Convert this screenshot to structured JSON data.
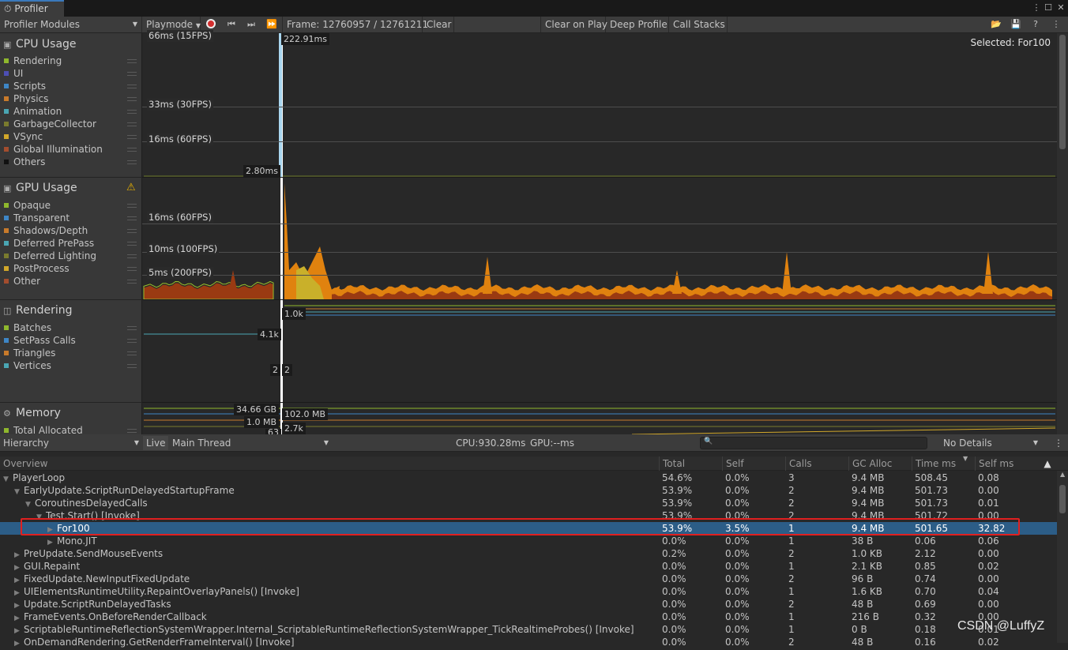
{
  "window": {
    "tab_label": "Profiler"
  },
  "toolbar": {
    "modules_label": "Profiler Modules",
    "playmode_label": "Playmode",
    "frame_label": "Frame: 12760957 / 12761211",
    "clear_label": "Clear",
    "clear_on_play_label": "Clear on Play",
    "deep_profile_label": "Deep Profile",
    "call_stacks_label": "Call Stacks"
  },
  "modules": {
    "cpu": {
      "title": "CPU Usage",
      "legend": [
        {
          "label": "Rendering",
          "color": "#8fb82d"
        },
        {
          "label": "UI",
          "color": "#4d4fb5"
        },
        {
          "label": "Scripts",
          "color": "#3e86c6"
        },
        {
          "label": "Physics",
          "color": "#c87a2b"
        },
        {
          "label": "Animation",
          "color": "#4aa6b3"
        },
        {
          "label": "GarbageCollector",
          "color": "#7a7b2e"
        },
        {
          "label": "VSync",
          "color": "#d1a72a"
        },
        {
          "label": "Global Illumination",
          "color": "#a34d2e"
        },
        {
          "label": "Others",
          "color": "#111111"
        }
      ]
    },
    "gpu": {
      "title": "GPU Usage",
      "legend": [
        {
          "label": "Opaque",
          "color": "#8fb82d"
        },
        {
          "label": "Transparent",
          "color": "#3e86c6"
        },
        {
          "label": "Shadows/Depth",
          "color": "#c87a2b"
        },
        {
          "label": "Deferred PrePass",
          "color": "#4aa6b3"
        },
        {
          "label": "Deferred Lighting",
          "color": "#7a7b2e"
        },
        {
          "label": "PostProcess",
          "color": "#d1a72a"
        },
        {
          "label": "Other",
          "color": "#a34d2e"
        }
      ]
    },
    "rendering": {
      "title": "Rendering",
      "legend": [
        {
          "label": "Batches",
          "color": "#8fb82d"
        },
        {
          "label": "SetPass Calls",
          "color": "#3e86c6"
        },
        {
          "label": "Triangles",
          "color": "#c87a2b"
        },
        {
          "label": "Vertices",
          "color": "#4aa6b3"
        }
      ]
    },
    "memory": {
      "title": "Memory",
      "legend": [
        {
          "label": "Total Allocated",
          "color": "#8fb82d"
        }
      ]
    }
  },
  "charts": {
    "selected_label": "Selected: For100",
    "cpu": {
      "top": "66ms (15FPS)",
      "l33": "33ms (30FPS)",
      "l16": "16ms (60FPS)",
      "frame_value": "222.91ms",
      "cur_value": "2.80ms"
    },
    "gpu": {
      "l16": "16ms (60FPS)",
      "l10": "10ms (100FPS)",
      "l5": "5ms (200FPS)"
    },
    "rendering": {
      "v1": "1.0k",
      "v2": "4.1k",
      "v3": "2",
      "v4": "2"
    },
    "memory": {
      "v1": "34.66 GB",
      "v2": "102.0 MB",
      "v3": "1.0 MB",
      "v4": "2.7k",
      "v5": "63"
    },
    "colors": {
      "gpu_orange": "#e0820f",
      "gpu_dark": "#9a3a12",
      "gpu_yellow": "#c9b02a",
      "selection": "#ffffff",
      "cpu_spike": "#a9d6ef"
    }
  },
  "bottom": {
    "view_label": "Hierarchy",
    "live_label": "Live",
    "thread_label": "Main Thread",
    "cpu_time": "CPU:930.28ms",
    "gpu_time": "GPU:--ms",
    "details_label": "No Details"
  },
  "table": {
    "columns": [
      "Overview",
      "Total",
      "Self",
      "Calls",
      "GC Alloc",
      "Time ms",
      "Self ms"
    ],
    "rows": [
      {
        "name": "PlayerLoop",
        "indent": 0,
        "arrow": "▼",
        "total": "54.6%",
        "self": "0.0%",
        "calls": "3",
        "gc": "9.4 MB",
        "time": "508.45",
        "selfms": "0.08"
      },
      {
        "name": "EarlyUpdate.ScriptRunDelayedStartupFrame",
        "indent": 1,
        "arrow": "▼",
        "total": "53.9%",
        "self": "0.0%",
        "calls": "2",
        "gc": "9.4 MB",
        "time": "501.73",
        "selfms": "0.00"
      },
      {
        "name": "CoroutinesDelayedCalls",
        "indent": 2,
        "arrow": "▼",
        "total": "53.9%",
        "self": "0.0%",
        "calls": "2",
        "gc": "9.4 MB",
        "time": "501.73",
        "selfms": "0.01"
      },
      {
        "name": "Test.Start() [Invoke]",
        "indent": 3,
        "arrow": "▼",
        "total": "53.9%",
        "self": "0.0%",
        "calls": "2",
        "gc": "9.4 MB",
        "time": "501.72",
        "selfms": "0.00"
      },
      {
        "name": "For100",
        "indent": 4,
        "arrow": "▶",
        "total": "53.9%",
        "self": "3.5%",
        "calls": "1",
        "gc": "9.4 MB",
        "time": "501.65",
        "selfms": "32.82",
        "selected": true
      },
      {
        "name": "Mono.JIT",
        "indent": 4,
        "arrow": "▶",
        "total": "0.0%",
        "self": "0.0%",
        "calls": "1",
        "gc": "38 B",
        "time": "0.06",
        "selfms": "0.06"
      },
      {
        "name": "PreUpdate.SendMouseEvents",
        "indent": 1,
        "arrow": "▶",
        "total": "0.2%",
        "self": "0.0%",
        "calls": "2",
        "gc": "1.0 KB",
        "time": "2.12",
        "selfms": "0.00"
      },
      {
        "name": "GUI.Repaint",
        "indent": 1,
        "arrow": "▶",
        "total": "0.0%",
        "self": "0.0%",
        "calls": "1",
        "gc": "2.1 KB",
        "time": "0.85",
        "selfms": "0.02"
      },
      {
        "name": "FixedUpdate.NewInputFixedUpdate",
        "indent": 1,
        "arrow": "▶",
        "total": "0.0%",
        "self": "0.0%",
        "calls": "2",
        "gc": "96 B",
        "time": "0.74",
        "selfms": "0.00"
      },
      {
        "name": "UIElementsRuntimeUtility.RepaintOverlayPanels() [Invoke]",
        "indent": 1,
        "arrow": "▶",
        "total": "0.0%",
        "self": "0.0%",
        "calls": "1",
        "gc": "1.6 KB",
        "time": "0.70",
        "selfms": "0.04"
      },
      {
        "name": "Update.ScriptRunDelayedTasks",
        "indent": 1,
        "arrow": "▶",
        "total": "0.0%",
        "self": "0.0%",
        "calls": "2",
        "gc": "48 B",
        "time": "0.69",
        "selfms": "0.00"
      },
      {
        "name": "FrameEvents.OnBeforeRenderCallback",
        "indent": 1,
        "arrow": "▶",
        "total": "0.0%",
        "self": "0.0%",
        "calls": "1",
        "gc": "216 B",
        "time": "0.32",
        "selfms": "0.00"
      },
      {
        "name": "ScriptableRuntimeReflectionSystemWrapper.Internal_ScriptableRuntimeReflectionSystemWrapper_TickRealtimeProbes() [Invoke]",
        "indent": 1,
        "arrow": "▶",
        "total": "0.0%",
        "self": "0.0%",
        "calls": "1",
        "gc": "0 B",
        "time": "0.18",
        "selfms": "0.01"
      },
      {
        "name": "OnDemandRendering.GetRenderFrameInterval() [Invoke]",
        "indent": 1,
        "arrow": "▶",
        "total": "0.0%",
        "self": "0.0%",
        "calls": "2",
        "gc": "48 B",
        "time": "0.16",
        "selfms": "0.02"
      }
    ]
  },
  "watermark": "CSDN @LuffyZ",
  "highlight_color": "#e02020"
}
